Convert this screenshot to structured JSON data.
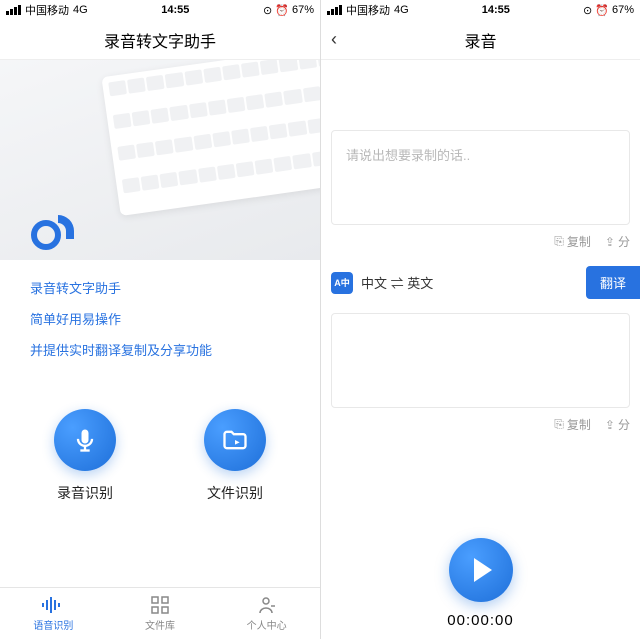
{
  "statusBar": {
    "carrier": "中国移动",
    "network": "4G",
    "time": "14:55",
    "battery": "67%"
  },
  "left": {
    "title": "录音转文字助手",
    "promo": {
      "line1": "录音转文字助手",
      "line2": "简单好用易操作",
      "line3": "并提供实时翻译复制及分享功能"
    },
    "actions": {
      "record": "录音识别",
      "file": "文件识别"
    },
    "tabs": {
      "voice": "语音识别",
      "files": "文件库",
      "profile": "个人中心"
    }
  },
  "right": {
    "title": "录音",
    "placeholder": "请说出想要录制的话..",
    "tools": {
      "copy": "复制",
      "share": "分"
    },
    "lang": {
      "from": "中文",
      "swap": "⇌",
      "to": "英文"
    },
    "translate": "翻译",
    "timer": "00:00:00"
  }
}
